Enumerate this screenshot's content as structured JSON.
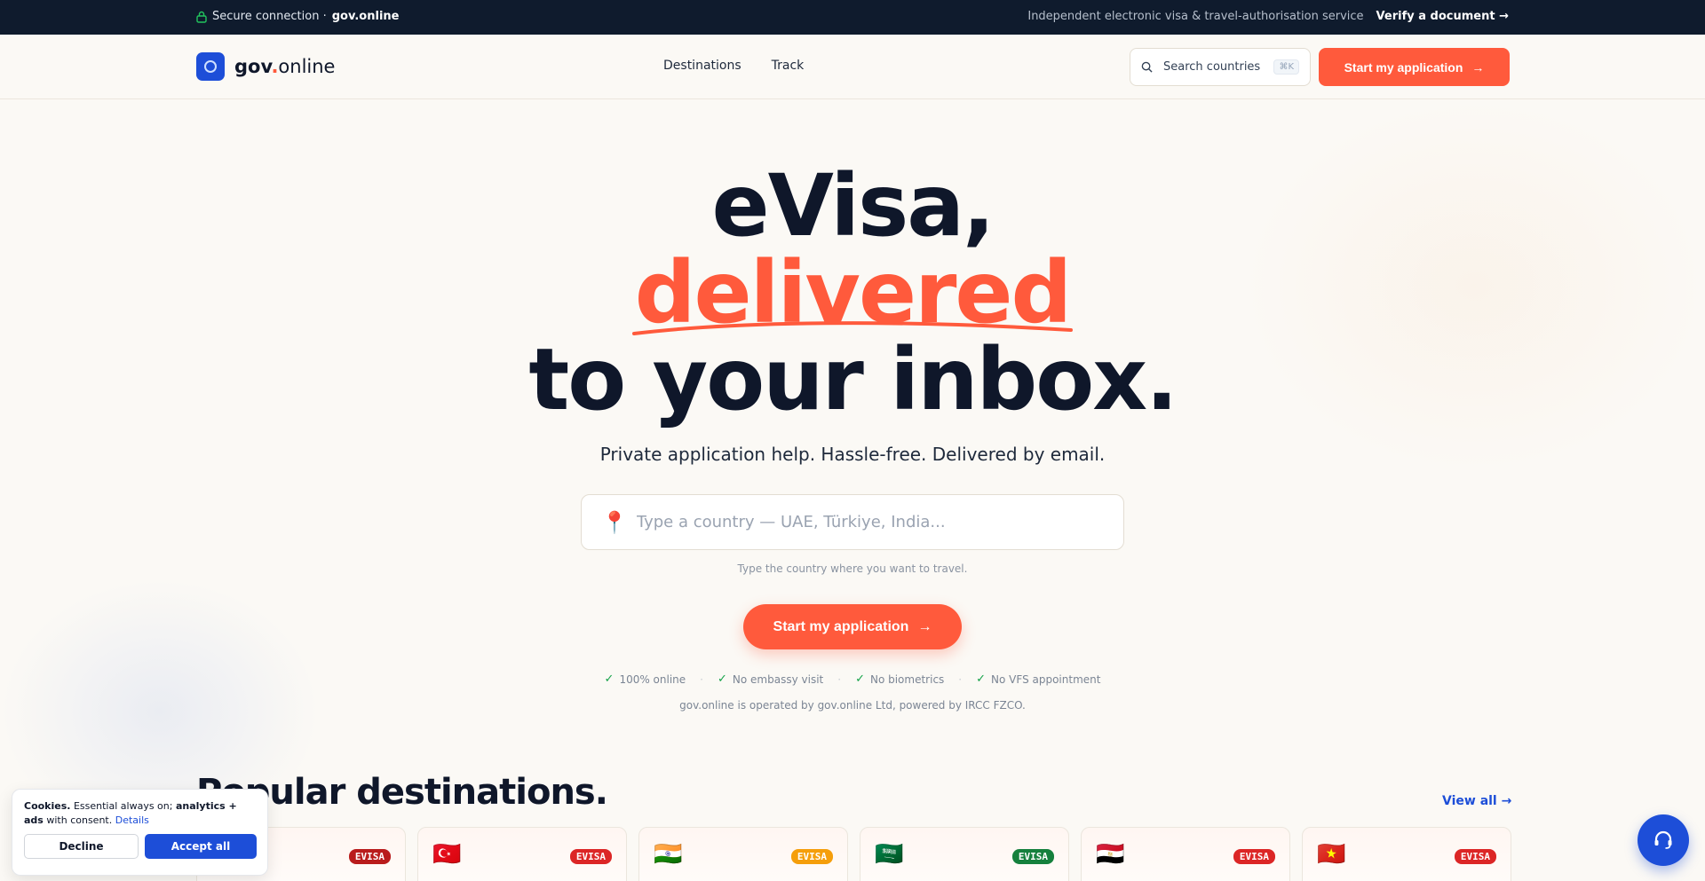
{
  "topbar": {
    "secure_label": "Secure connection ·",
    "secure_domain": "gov.online",
    "tagline": "Independent electronic visa & travel-authorisation service",
    "verify_label": "Verify a document",
    "verify_arrow": "→"
  },
  "header": {
    "logo_gov": "gov",
    "logo_dot": ".",
    "logo_online": "online",
    "nav": [
      "Destinations",
      "Track"
    ],
    "search_label": "Search countries",
    "search_shortcut": "⌘K",
    "cta_label": "Start my application",
    "cta_arrow": "→"
  },
  "hero": {
    "line1": "eVisa,",
    "line2": "delivered",
    "line3": "to your inbox.",
    "subtitle": "Private application help. Hassle-free. Delivered by email.",
    "country_placeholder": "Type a country — UAE, Türkiye, India...",
    "country_value": "",
    "hint": "Type the country where you want to travel.",
    "cta_label": "Start my application",
    "cta_arrow": "→",
    "checks": [
      "100% online",
      "No embassy visit",
      "No biometrics",
      "No VFS appointment"
    ],
    "operated": "gov.online is operated by gov.online Ltd, powered by IRCC FZCO."
  },
  "destinations": {
    "title": "Popular destinations.",
    "view_all": "View all →",
    "cards": [
      {
        "flag": "",
        "badge": "EVISA",
        "badge_color": "#b91c1c"
      },
      {
        "flag": "🇹🇷",
        "badge": "EVISA",
        "badge_color": "#dc2626"
      },
      {
        "flag": "🇮🇳",
        "badge": "EVISA",
        "badge_color": "#f59e0b"
      },
      {
        "flag": "🇸🇦",
        "badge": "EVISA",
        "badge_color": "#15803d"
      },
      {
        "flag": "🇪🇬",
        "badge": "EVISA",
        "badge_color": "#dc2626"
      },
      {
        "flag": "🇻🇳",
        "badge": "EVISA",
        "badge_color": "#dc2626"
      }
    ]
  },
  "cookie": {
    "title": "Cookies.",
    "text1": "Essential always on;",
    "text2": "analytics + ads",
    "text3": "with consent.",
    "details": "Details",
    "decline": "Decline",
    "accept": "Accept all"
  },
  "icons": {
    "lock": "lock-icon",
    "search": "search-icon",
    "pin": "map-pin-icon",
    "check": "check-icon",
    "headset": "headset-icon"
  },
  "colors": {
    "accent": "#ff5a3c",
    "brand": "#1d4ed8",
    "dark": "#0f172a",
    "topbar": "#0f1b2d"
  }
}
